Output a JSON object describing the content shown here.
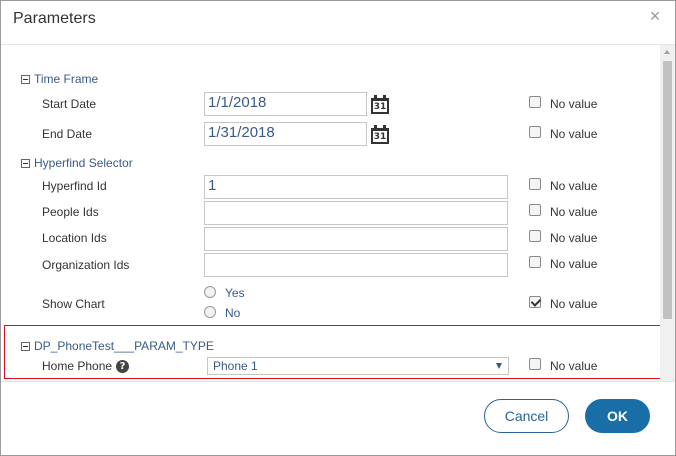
{
  "dialog": {
    "title": "Parameters",
    "close_glyph": "×"
  },
  "groups": {
    "time_frame": {
      "title": "Time Frame",
      "start_label": "Start Date",
      "start_value": "1/1/2018",
      "end_label": "End Date",
      "end_value": "1/31/2018",
      "calendar_day": "31"
    },
    "hyperfind": {
      "title": "Hyperfind Selector",
      "hyperfind_id_label": "Hyperfind Id",
      "hyperfind_id_value": "1",
      "people_ids_label": "People Ids",
      "location_ids_label": "Location Ids",
      "organization_ids_label": "Organization Ids",
      "show_chart_label": "Show Chart",
      "yes_label": "Yes",
      "no_label": "No"
    },
    "phone": {
      "title": "DP_PhoneTest___PARAM_TYPE",
      "home_phone_label": "Home Phone",
      "help_glyph": "?",
      "selected": "Phone 1"
    }
  },
  "no_value_label": "No value",
  "no_value_checked": {
    "start_date": false,
    "end_date": false,
    "hyperfind_id": false,
    "people_ids": false,
    "location_ids": false,
    "organization_ids": false,
    "show_chart": true,
    "home_phone": false
  },
  "footer": {
    "cancel_label": "Cancel",
    "ok_label": "OK"
  },
  "colors": {
    "accent": "#1a6ea8",
    "highlight_border": "#d9121b",
    "link_text": "#3a5a8a"
  }
}
